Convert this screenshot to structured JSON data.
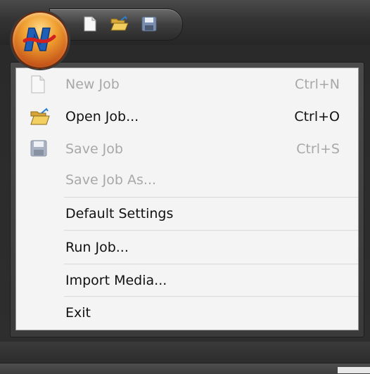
{
  "app": {
    "orb_icon": "app-logo-icon",
    "quick_access": [
      {
        "name": "new-job",
        "icon": "new-document-icon"
      },
      {
        "name": "open-job",
        "icon": "open-folder-icon"
      },
      {
        "name": "save-job",
        "icon": "save-disk-icon"
      }
    ]
  },
  "menu": {
    "items": [
      {
        "label": "New Job",
        "shortcut": "Ctrl+N",
        "icon": "new-document-icon",
        "enabled": false
      },
      {
        "label": "Open Job...",
        "shortcut": "Ctrl+O",
        "icon": "open-folder-icon",
        "enabled": true
      },
      {
        "label": "Save Job",
        "shortcut": "Ctrl+S",
        "icon": "save-disk-icon",
        "enabled": false
      },
      {
        "label": "Save Job As...",
        "shortcut": "",
        "icon": "",
        "enabled": false
      },
      {
        "label": "Default Settings",
        "shortcut": "",
        "icon": "",
        "enabled": true
      },
      {
        "label": "Run Job...",
        "shortcut": "",
        "icon": "",
        "enabled": true
      },
      {
        "label": "Import Media...",
        "shortcut": "",
        "icon": "",
        "enabled": true
      },
      {
        "label": "Exit",
        "shortcut": "",
        "icon": "",
        "enabled": true
      }
    ]
  }
}
